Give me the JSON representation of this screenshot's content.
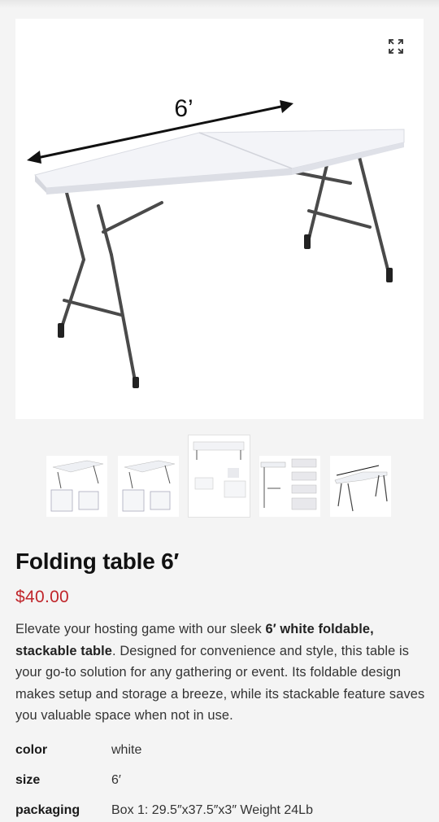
{
  "product": {
    "title": "Folding table 6′",
    "price": "$40.00",
    "image_label": "6’",
    "description": {
      "part1": "Elevate your hosting game with our sleek ",
      "bold1": "6′ white foldable,",
      "bold2": "stackable table",
      "part2": ". Designed for convenience and style, this table is your go-to solution for any gathering or event. Its foldable design makes setup and storage a breeze, while its stackable feature saves you valuable space when not in use."
    },
    "specs": [
      {
        "key": "color",
        "value": "white"
      },
      {
        "key": "size",
        "value": "6′"
      },
      {
        "key": "packaging",
        "value": "Box 1: 29.5″x37.5″x3″ Weight 24Lb"
      }
    ]
  },
  "gallery": {
    "selected_index": 2,
    "thumbnail_count": 5
  },
  "icons": {
    "expand": "expand-icon"
  },
  "colors": {
    "price": "#c0262b",
    "background": "#f4f4f4"
  }
}
